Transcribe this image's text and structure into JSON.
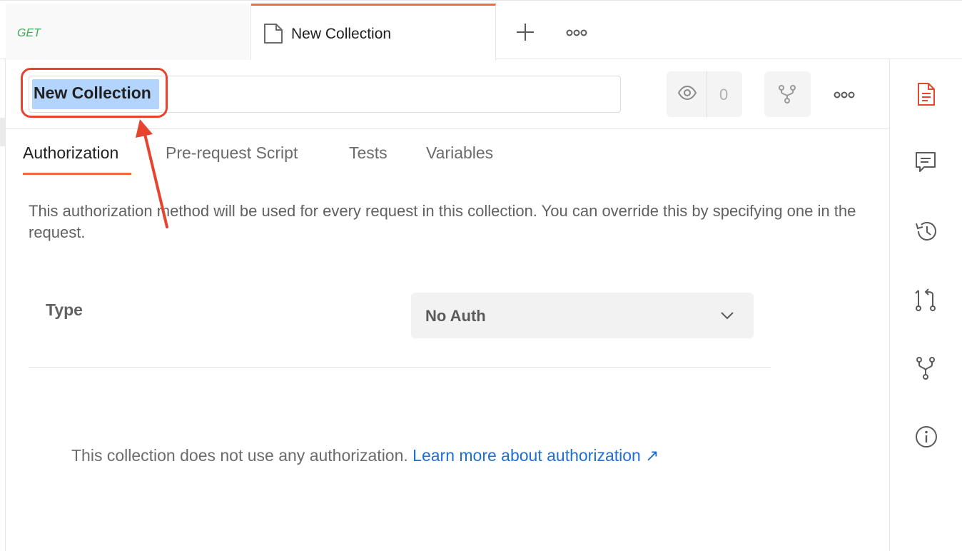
{
  "tabs": {
    "get_tab": {
      "method": "GET"
    },
    "active_tab": {
      "title": "New Collection",
      "icon": "collection-doc-icon"
    }
  },
  "header": {
    "collection_name": "New Collection",
    "watch_count": "0"
  },
  "subtabs": [
    "Authorization",
    "Pre-request Script",
    "Tests",
    "Variables"
  ],
  "auth": {
    "description": "This authorization method will be used for every request in this collection. You can override this by specifying one in the request.",
    "type_label": "Type",
    "type_value": "No Auth",
    "no_auth_text": "This collection does not use any authorization.",
    "learn_more": "Learn more about authorization ↗"
  },
  "right_rail": [
    "documentation-icon",
    "comments-icon",
    "history-icon",
    "pull-request-icon",
    "fork-icon",
    "info-icon"
  ],
  "colors": {
    "accent": "#ef6c3e",
    "get_method": "#3cab5a",
    "link": "#1f6fcf",
    "annotation": "#e8432f",
    "selection": "#b3d4fc"
  }
}
